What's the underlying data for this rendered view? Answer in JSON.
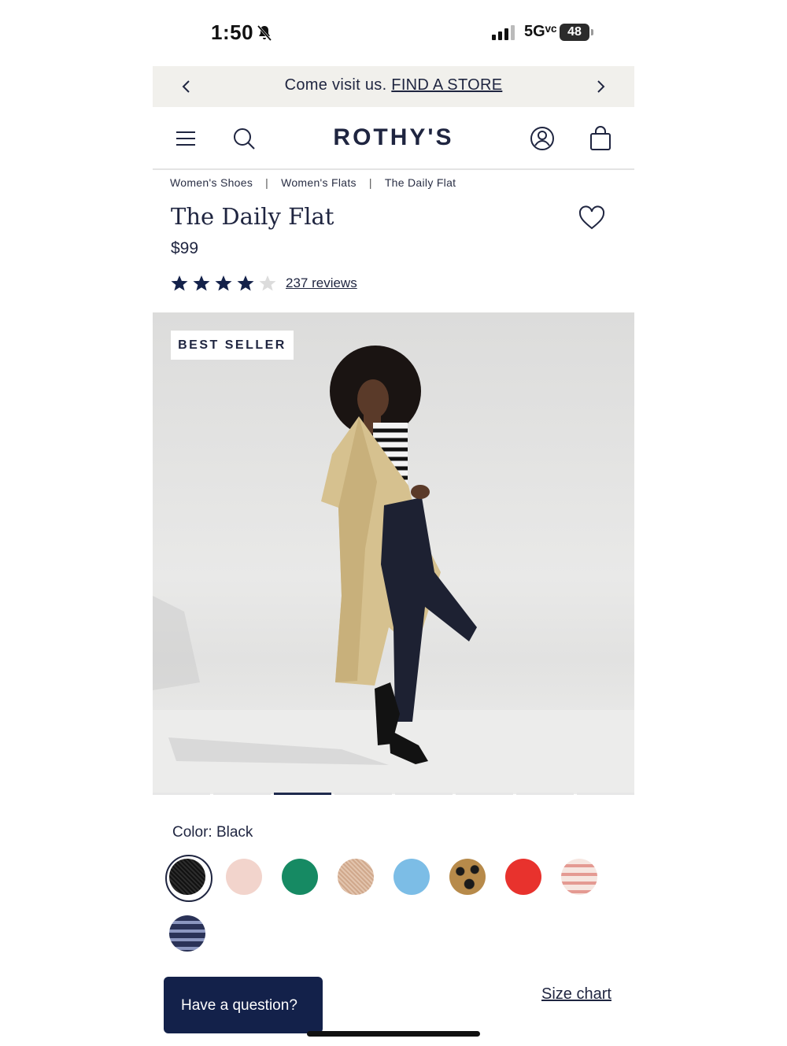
{
  "status_bar": {
    "time": "1:50",
    "network": "5Gᵛᶜ",
    "battery": "48"
  },
  "promo": {
    "text": "Come visit us.",
    "link": "FIND A STORE"
  },
  "header": {
    "logo": "ROTHY'S"
  },
  "breadcrumb": [
    "Women's Shoes",
    "Women's Flats",
    "The Daily Flat"
  ],
  "product": {
    "title": "The Daily Flat",
    "price": "$99",
    "rating": 4,
    "rating_max": 5,
    "reviews": "237 reviews",
    "badge": "BEST SELLER"
  },
  "gallery": {
    "slides": 8,
    "active_slide": 3
  },
  "color": {
    "label": "Color:",
    "value": "Black",
    "swatches": [
      {
        "name": "Black",
        "color": "#1c1c1c"
      },
      {
        "name": "Blush",
        "color": "#f2d4cc"
      },
      {
        "name": "Green",
        "color": "#168a63"
      },
      {
        "name": "Sand",
        "color": "#d6b196"
      },
      {
        "name": "Sky Blue",
        "color": "#7cbde6"
      },
      {
        "name": "Leopard",
        "color": "#b78a4a"
      },
      {
        "name": "Red",
        "color": "#e8322d"
      },
      {
        "name": "Pink Stripe",
        "color": "#f0c1b8"
      },
      {
        "name": "Navy Stripe",
        "color": "#3c4670"
      }
    ]
  },
  "chat": {
    "label": "Have a question?"
  },
  "size_chart": "Size chart"
}
